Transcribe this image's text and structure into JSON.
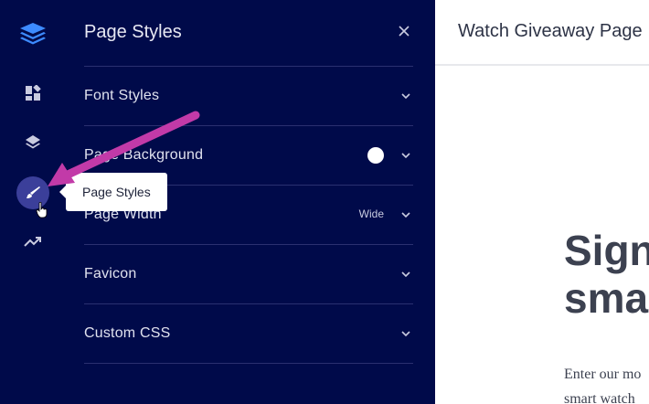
{
  "rail": {
    "items": [
      {
        "icon": "layers-logo-icon"
      },
      {
        "icon": "dashboard-icon"
      },
      {
        "icon": "layers-icon"
      },
      {
        "icon": "brush-icon",
        "active": true
      },
      {
        "icon": "trending-up-icon"
      }
    ],
    "active_color": "#3b3f9a"
  },
  "panel": {
    "title": "Page Styles",
    "rows": [
      {
        "label": "Font Styles"
      },
      {
        "label": "Page Background",
        "swatch": "#ffffff"
      },
      {
        "label": "Page Width",
        "value": "Wide"
      },
      {
        "label": "Favicon"
      },
      {
        "label": "Custom CSS"
      }
    ]
  },
  "tooltip": {
    "text": "Page Styles"
  },
  "preview": {
    "page_title": "Watch Giveaway Page",
    "heading": "Sign\nsma",
    "body": "Enter our mo\nsmart watch"
  },
  "colors": {
    "sidebar_bg": "#000a4a",
    "arrow": "#c23aa8"
  }
}
